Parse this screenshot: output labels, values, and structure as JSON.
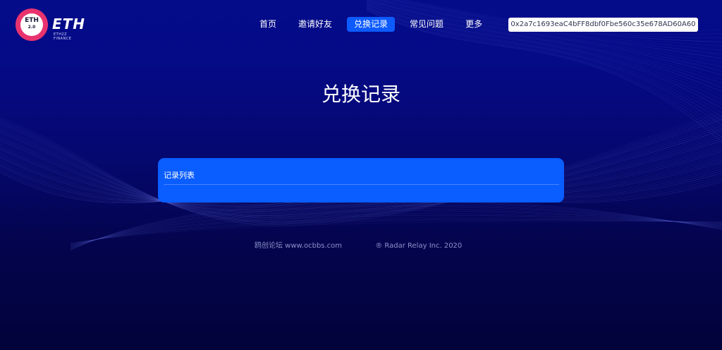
{
  "brand": {
    "badge_text": "ETH",
    "badge_sub": "2.0",
    "wordmark": "ETH",
    "tagline": "ETH2Z FINANCE"
  },
  "nav": {
    "items": [
      {
        "label": "首页"
      },
      {
        "label": "邀请好友"
      },
      {
        "label": "兑换记录",
        "active": true
      },
      {
        "label": "常见问题"
      },
      {
        "label": "更多"
      }
    ]
  },
  "wallet": {
    "address": "0x2a7c1693eaC4bFF8dbf0Fbe560c35e678AD60A60"
  },
  "page": {
    "title": "兑换记录"
  },
  "records_card": {
    "title": "记录列表"
  },
  "footer": {
    "forum": "鸥创论坛 www.ocbbs.com",
    "copyright": "® Radar Relay Inc. 2020"
  },
  "colors": {
    "background_top": "#040c8a",
    "background_bottom": "#02033a",
    "accent": "#0d5bff",
    "card": "#0a5dff",
    "logo_pink": "#e8336e"
  }
}
